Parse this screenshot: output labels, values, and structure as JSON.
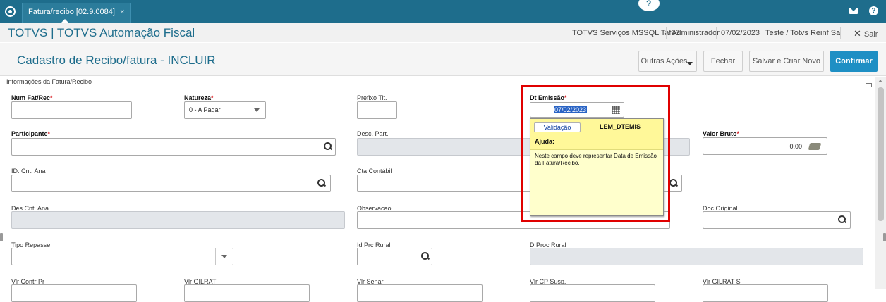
{
  "topbar": {
    "tab_label": "Fatura/recibo [02.9.0084]",
    "tab_close": "×"
  },
  "appbar": {
    "title": "TOTVS | TOTVS Automação Fiscal",
    "server": "TOTVS Serviços MSSQL Taf33",
    "user": "Administrador",
    "date": "07/02/2023",
    "company": "Teste / Totvs Reinf Sa",
    "exit": "Sair"
  },
  "header": {
    "title": "Cadastro de Recibo/fatura - INCLUIR",
    "buttons": {
      "other_actions": "Outras Ações",
      "close": "Fechar",
      "save_new": "Salvar e Criar Novo",
      "confirm": "Confirmar"
    }
  },
  "form": {
    "section": "Informações da Fatura/Recibo",
    "required_mark": "*",
    "fields": {
      "num_fat": {
        "label": "Num Fat/Rec",
        "value": ""
      },
      "natureza": {
        "label": "Natureza",
        "value": "0 - A Pagar"
      },
      "prefixo": {
        "label": "Prefixo Tit.",
        "value": ""
      },
      "dt_emissao": {
        "label": "Dt Emissão",
        "value": "07/02/2023"
      },
      "participante": {
        "label": "Participante",
        "value": ""
      },
      "desc_part": {
        "label": "Desc. Part.",
        "value": ""
      },
      "valor_bruto": {
        "label": "Valor Bruto",
        "value": "0,00"
      },
      "id_cnt_ana": {
        "label": "ID. Cnt. Ana",
        "value": ""
      },
      "cta_contabil": {
        "label": "Cta Contábil",
        "value": ""
      },
      "des_cnt_ana": {
        "label": "Des Cnt. Ana",
        "value": ""
      },
      "observacao": {
        "label": "Observacao",
        "value": ""
      },
      "doc_original": {
        "label": "Doc Original",
        "value": ""
      },
      "tipo_repasse": {
        "label": "Tipo Repasse",
        "value": ""
      },
      "id_prc_rural": {
        "label": "Id Prc Rural",
        "value": ""
      },
      "d_proc_rural": {
        "label": "D Proc Rural",
        "value": ""
      },
      "vlr_contr_pr": {
        "label": "Vlr Contr Pr",
        "value": ""
      },
      "vlr_gilrat": {
        "label": "Vlr GILRAT",
        "value": ""
      },
      "vlr_senar": {
        "label": "Vlr Senar",
        "value": ""
      },
      "vlr_cp_susp": {
        "label": "Vlr CP Susp.",
        "value": ""
      },
      "vlr_gilrat_s": {
        "label": "Vlr GILRAT S",
        "value": ""
      }
    }
  },
  "tooltip": {
    "button": "Validação",
    "code": "LEM_DTEMIS",
    "help_title": "Ajuda:",
    "help_text": "Neste campo deve representar Data de Emissão da Fatura/Recibo."
  },
  "colors": {
    "topbar": "#1e6d8c",
    "accent": "#1e8fc4",
    "highlight": "#e00000",
    "tooltip_bg": "#ffffcc"
  }
}
